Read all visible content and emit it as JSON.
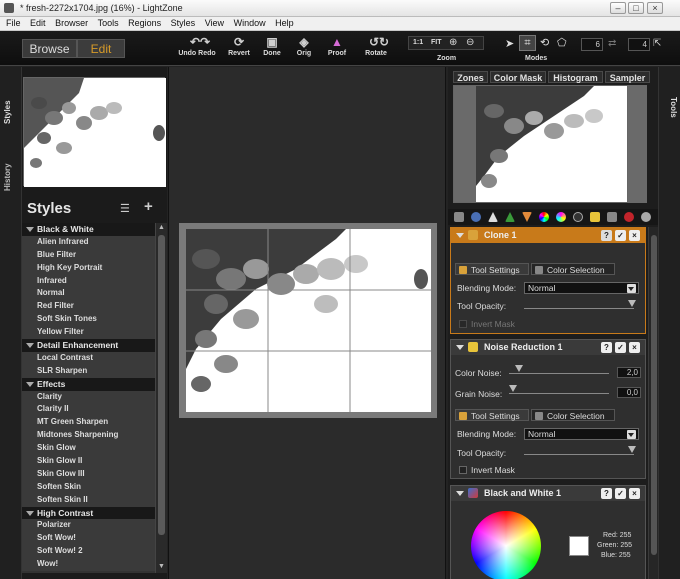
{
  "window": {
    "title": "* fresh-2272x1704.jpg (16%) - LightZone"
  },
  "menu": [
    "File",
    "Edit",
    "Browser",
    "Tools",
    "Regions",
    "Styles",
    "View",
    "Window",
    "Help"
  ],
  "modes_tabs": {
    "browse": "Browse",
    "edit": "Edit"
  },
  "toolbar": {
    "undo_redo": "Undo Redo",
    "revert": "Revert",
    "done": "Done",
    "orig": "Orig",
    "proof": "Proof",
    "rotate": "Rotate",
    "zoom_label": "Zoom",
    "zoom_1to1": "1:1",
    "zoom_fit": "FIT",
    "modes_label": "Modes",
    "num_left": "6",
    "num_right": "4"
  },
  "left_tabs": {
    "styles": "Styles",
    "history": "History"
  },
  "styles_panel": {
    "title": "Styles",
    "groups": [
      {
        "name": "Black & White",
        "items": [
          "Alien Infrared",
          "Blue Filter",
          "High Key Portrait",
          "Infrared",
          "Normal",
          "Red Filter",
          "Soft Skin Tones",
          "Yellow Filter"
        ]
      },
      {
        "name": "Detail Enhancement",
        "items": [
          "Local Contrast",
          "SLR Sharpen"
        ]
      },
      {
        "name": "Effects",
        "items": [
          "Clarity",
          "Clarity II",
          "MT Green Sharpen",
          "Midtones Sharpening",
          "Skin Glow",
          "Skin Glow II",
          "Skin Glow III",
          "Soften Skin",
          "Soften Skin II"
        ]
      },
      {
        "name": "High Contrast",
        "items": [
          "Polarizer",
          "Soft Wow!",
          "Soft Wow! 2",
          "Wow!"
        ]
      }
    ]
  },
  "right_tabs": {
    "tools": "Tools"
  },
  "zone_tabs": [
    "Zones",
    "Color Mask",
    "Histogram",
    "Sampler"
  ],
  "tool_stack": {
    "clone": {
      "name": "Clone 1",
      "tab_settings": "Tool Settings",
      "tab_color": "Color Selection",
      "blending_label": "Blending Mode:",
      "blending_value": "Normal",
      "opacity_label": "Tool Opacity:",
      "invert_label": "Invert Mask"
    },
    "noise": {
      "name": "Noise Reduction 1",
      "color_noise_label": "Color Noise:",
      "color_noise_value": "2,0",
      "grain_noise_label": "Grain Noise:",
      "grain_noise_value": "0,0",
      "tab_settings": "Tool Settings",
      "tab_color": "Color Selection",
      "blending_label": "Blending Mode:",
      "blending_value": "Normal",
      "opacity_label": "Tool Opacity:",
      "invert_label": "Invert Mask"
    },
    "bw": {
      "name": "Black and White 1",
      "red_label": "Red:",
      "red_value": "255",
      "green_label": "Green:",
      "green_value": "255",
      "blue_label": "Blue:",
      "blue_value": "255"
    }
  },
  "colors": {
    "accent_orange": "#c87a1a",
    "edit_tab": "#d69a28"
  }
}
